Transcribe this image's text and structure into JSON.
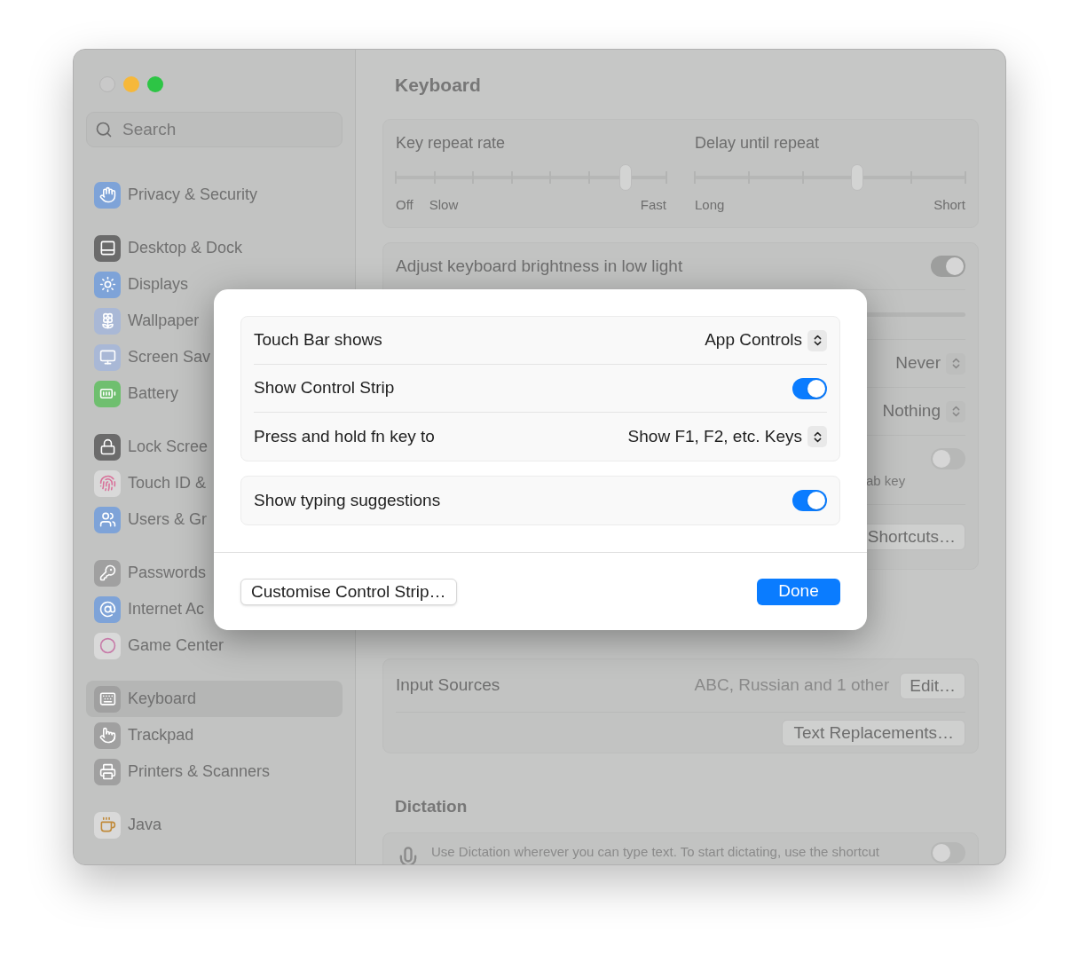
{
  "window": {
    "title": "Keyboard"
  },
  "sidebar": {
    "search": {
      "placeholder": "Search"
    },
    "groups": [
      [
        {
          "label": "Privacy & Security",
          "selected": false
        }
      ],
      [
        {
          "label": "Desktop & Dock",
          "selected": false
        },
        {
          "label": "Displays",
          "selected": false
        },
        {
          "label": "Wallpaper",
          "selected": false
        },
        {
          "label": "Screen Sav",
          "selected": false
        },
        {
          "label": "Battery",
          "selected": false
        }
      ],
      [
        {
          "label": "Lock Scree",
          "selected": false
        },
        {
          "label": "Touch ID &",
          "selected": false
        },
        {
          "label": "Users & Gr",
          "selected": false
        }
      ],
      [
        {
          "label": "Passwords",
          "selected": false
        },
        {
          "label": "Internet Ac",
          "selected": false
        },
        {
          "label": "Game Center",
          "selected": false
        }
      ],
      [
        {
          "label": "Keyboard",
          "selected": true
        },
        {
          "label": "Trackpad",
          "selected": false
        },
        {
          "label": "Printers & Scanners",
          "selected": false
        }
      ],
      [
        {
          "label": "Java",
          "selected": false
        }
      ]
    ]
  },
  "sliders": [
    {
      "label": "Key repeat rate",
      "level": 0.85,
      "marks": [
        "Off",
        "Slow",
        "Fast"
      ]
    },
    {
      "label": "Delay until repeat",
      "level": 0.6,
      "marks": [
        "Long",
        "Short"
      ]
    }
  ],
  "keyboard_settings": [
    {
      "kind": "toggle",
      "label": "Adjust keyboard brightness in low light",
      "on": true
    },
    {
      "kind": "track"
    },
    {
      "kind": "popup",
      "value": "Never"
    },
    {
      "kind": "popup",
      "value": "Nothing"
    },
    {
      "kind": "toggle-note",
      "note": "ab key",
      "on": false
    },
    {
      "kind": "button",
      "label": "Shortcuts…"
    }
  ],
  "text_input": {
    "label": "Input Sources",
    "value": "ABC, Russian and 1 other",
    "edit_button": "Edit…",
    "replacements_button": "Text Replacements…"
  },
  "dictation": {
    "heading": "Dictation",
    "text": "Use Dictation wherever you can type text. To start dictating, use the shortcut",
    "on": false
  },
  "sheet": {
    "groups": [
      [
        {
          "kind": "popup",
          "label": "Touch Bar shows",
          "value": "App Controls"
        },
        {
          "kind": "toggle",
          "label": "Show Control Strip",
          "on": true
        },
        {
          "kind": "popup",
          "label": "Press and hold fn key to",
          "value": "Show F1, F2, etc. Keys"
        }
      ],
      [
        {
          "kind": "toggle",
          "label": "Show typing suggestions",
          "on": true
        }
      ]
    ],
    "secondary_button": "Customise Control Strip…",
    "primary_button": "Done"
  }
}
